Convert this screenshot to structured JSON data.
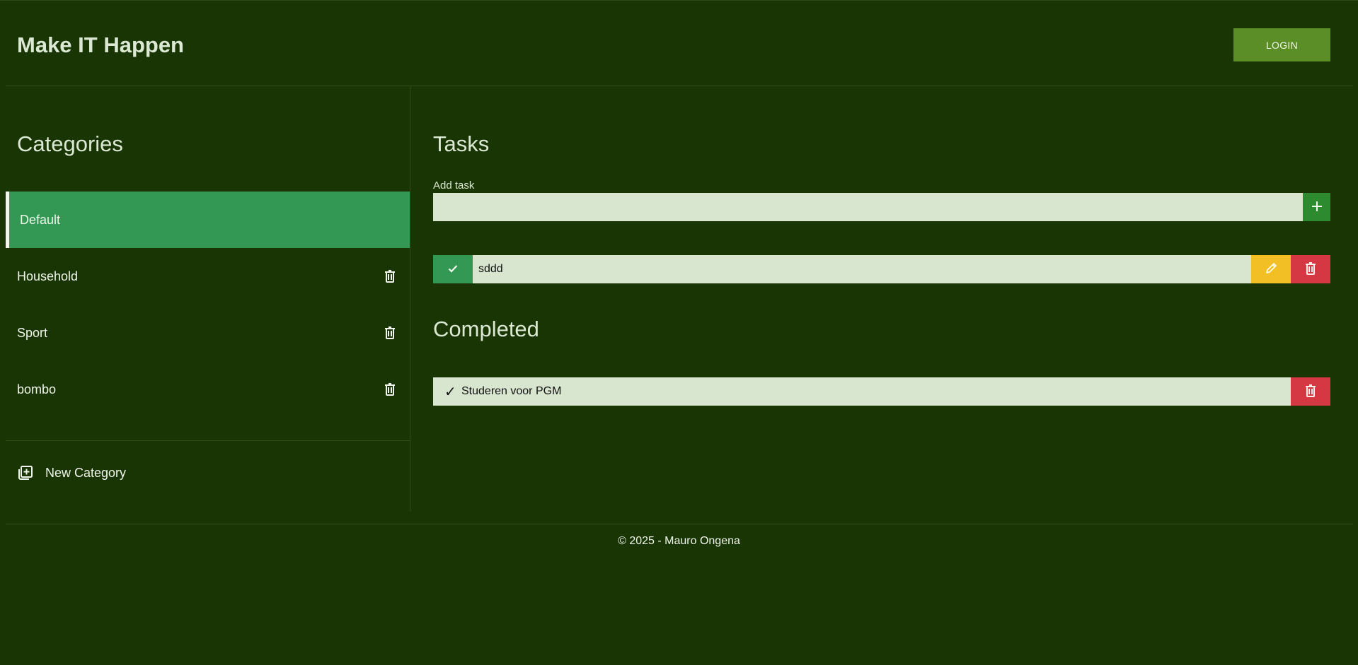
{
  "header": {
    "brand": "Make IT Happen",
    "login_label": "LOGIN"
  },
  "sidebar": {
    "title": "Categories",
    "items": [
      {
        "label": "Default",
        "active": true
      },
      {
        "label": "Household"
      },
      {
        "label": "Sport"
      },
      {
        "label": "bombo"
      }
    ],
    "new_category_label": "New Category"
  },
  "tasks": {
    "title": "Tasks",
    "add_label": "Add task",
    "add_value": "",
    "items": [
      {
        "text": "sddd"
      }
    ]
  },
  "completed": {
    "title": "Completed",
    "items": [
      {
        "mark": "✓",
        "text": "Studeren voor PGM"
      }
    ]
  },
  "footer": {
    "text": "© 2025 - Mauro Ongena"
  },
  "colors": {
    "background": "#183503",
    "active_category": "#339853",
    "login": "#5c8e28",
    "add": "#2e8a2e",
    "edit": "#f2bf25",
    "delete": "#d63843"
  },
  "icons": {
    "add": "plus-icon",
    "complete": "check-icon",
    "edit": "pencil-icon",
    "delete": "trash-icon",
    "new_category": "add-library-icon"
  }
}
